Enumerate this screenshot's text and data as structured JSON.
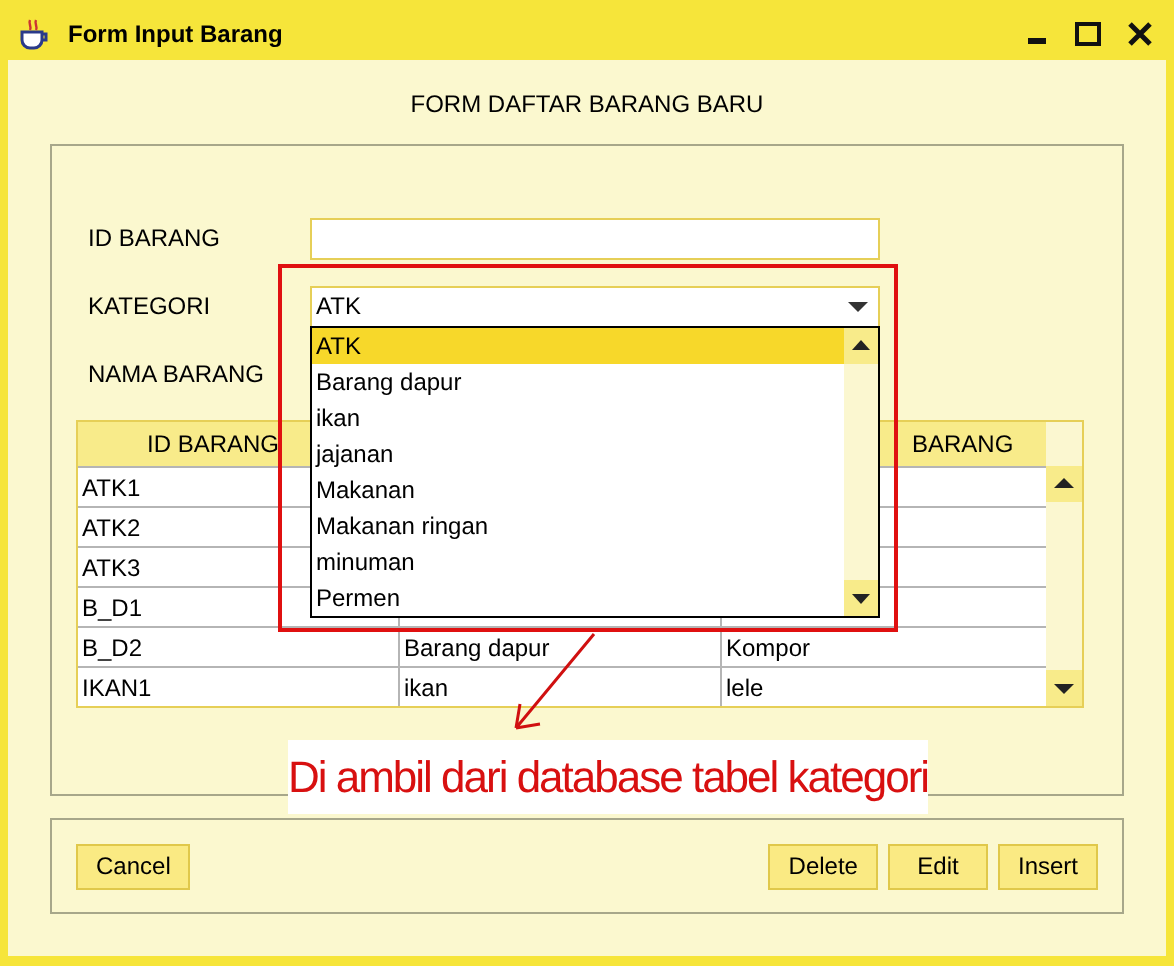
{
  "window": {
    "title": "Form Input Barang"
  },
  "heading": "FORM DAFTAR BARANG BARU",
  "fields": [
    {
      "kind": "text",
      "label": "ID BARANG"
    },
    {
      "kind": "combo",
      "label": "KATEGORI",
      "value": "ATK",
      "expanded": true,
      "options": [
        {
          "label": "ATK",
          "selected": true
        },
        {
          "label": "Barang dapur",
          "selected": false
        },
        {
          "label": "ikan",
          "selected": false
        },
        {
          "label": "jajanan",
          "selected": false
        },
        {
          "label": "Makanan",
          "selected": false
        },
        {
          "label": "Makanan ringan",
          "selected": false
        },
        {
          "label": "minuman",
          "selected": false
        },
        {
          "label": "Permen",
          "selected": false
        }
      ]
    },
    {
      "kind": "label",
      "label": "NAMA BARANG"
    }
  ],
  "table": {
    "columns": [
      "ID BARANG",
      "",
      "BARANG"
    ],
    "rows": [
      [
        "ATK1",
        "",
        ""
      ],
      [
        "ATK2",
        "",
        ""
      ],
      [
        "ATK3",
        "",
        ""
      ],
      [
        "B_D1",
        "",
        ""
      ],
      [
        "B_D2",
        "Barang dapur",
        "Kompor"
      ],
      [
        "IKAN1",
        "ikan",
        "lele"
      ]
    ]
  },
  "annotation": "Di ambil dari database tabel kategori",
  "buttons": [
    {
      "label": "Cancel"
    },
    {
      "label": "Delete"
    },
    {
      "label": "Edit"
    },
    {
      "label": "Insert"
    }
  ]
}
